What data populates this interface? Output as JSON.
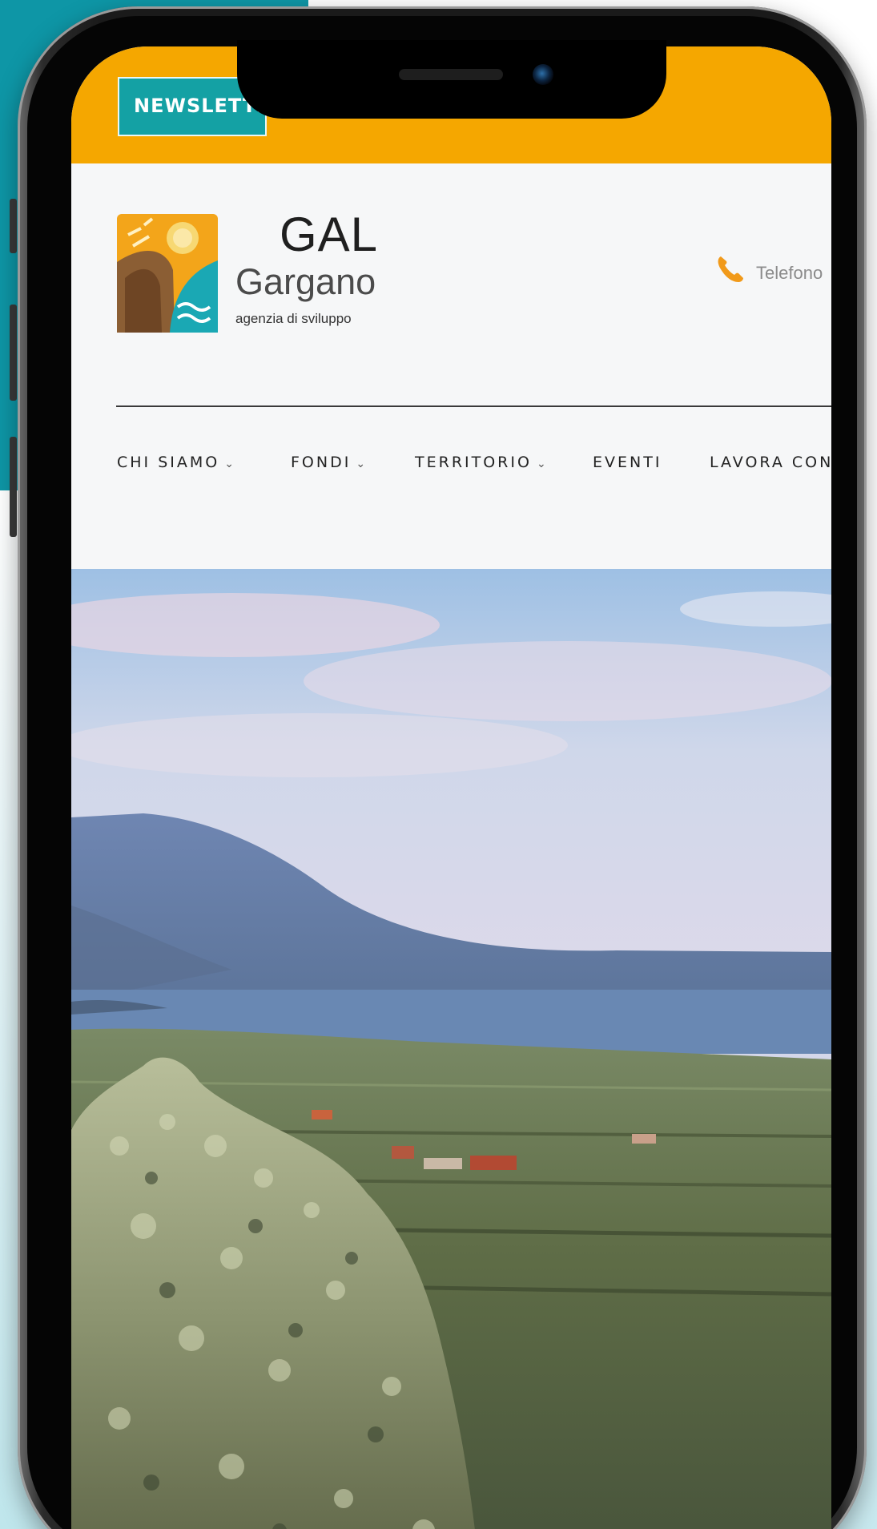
{
  "topbar": {
    "newsletter_label": "NEWSLETTER",
    "bg_color": "#f5a700",
    "button_color": "#14a1a4"
  },
  "brand": {
    "name": "GAL",
    "subname": "Gargano",
    "tagline": "agenzia di sviluppo"
  },
  "contact": {
    "icon": "phone-icon",
    "label": "Telefono"
  },
  "nav": {
    "items": [
      {
        "label": "CHI SIAMO",
        "has_dropdown": true
      },
      {
        "label": "FONDI",
        "has_dropdown": true
      },
      {
        "label": "TERRITORIO",
        "has_dropdown": true
      },
      {
        "label": "EVENTI",
        "has_dropdown": false
      },
      {
        "label": "LAVORA CON NOI",
        "has_dropdown": false
      }
    ]
  },
  "hero": {
    "image": "gargano-landscape"
  },
  "colors": {
    "accent_teal": "#0e96a6",
    "accent_orange": "#f5a700"
  }
}
